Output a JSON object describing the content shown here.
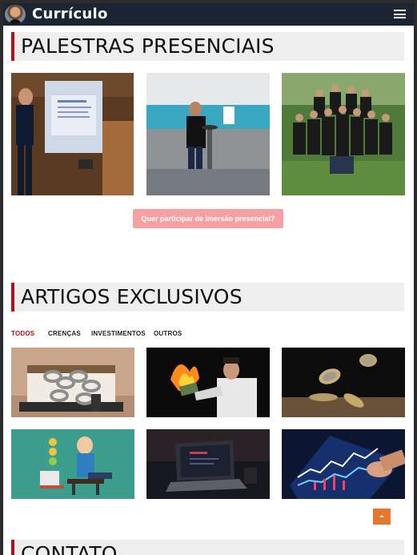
{
  "header": {
    "brand": "Currículo",
    "menu_icon": "hamburger-icon"
  },
  "palestras": {
    "title": "PALESTRAS PRESENCIAIS",
    "cta_label": "Quer participar de imersão presencial?"
  },
  "artigos": {
    "title": "ARTIGOS EXCLUSIVOS",
    "filters": [
      "TODOS",
      "CRENÇAS",
      "INVESTIMENTOS",
      "OUTROS"
    ],
    "active_filter": "TODOS"
  },
  "contato": {
    "title": "CONTATO"
  },
  "colors": {
    "accent": "#b0121b",
    "topbar": "#1c2533",
    "cta": "#f7a0a3",
    "back_to_top": "#e8772e"
  }
}
